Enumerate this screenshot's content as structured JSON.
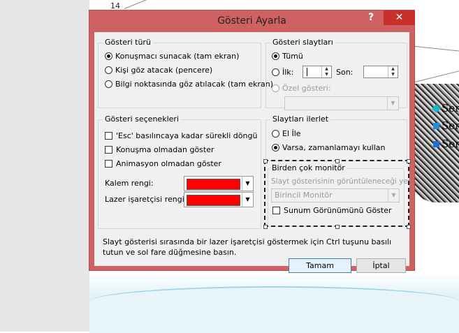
{
  "dialog": {
    "title": "Gösteri Ayarla",
    "help_glyph": "?",
    "close_glyph": "✕"
  },
  "show_type": {
    "group_label": "Gösteri türü",
    "options": [
      {
        "label": "Konuşmacı sunacak (tam ekran)",
        "selected": true
      },
      {
        "label": "Kişi göz atacak (pencere)",
        "selected": false
      },
      {
        "label": "Bilgi noktasında göz atılacak (tam ekran)",
        "selected": false
      }
    ]
  },
  "show_slides": {
    "group_label": "Gösteri slaytları",
    "all_label": "Tümü",
    "from_label": "İlk:",
    "to_label": "Son:",
    "from_value": "",
    "to_value": "",
    "custom_label": "Özel gösteri:",
    "custom_value": ""
  },
  "show_options": {
    "group_label": "Gösteri seçenekleri",
    "checks": [
      {
        "label": "'Esc' basılıncaya kadar sürekli döngü",
        "checked": false
      },
      {
        "label": "Konuşma olmadan göster",
        "checked": false
      },
      {
        "label": "Animasyon olmadan göster",
        "checked": false
      }
    ],
    "pen_color_label": "Kalem rengi:",
    "laser_color_label": "Lazer işaretçisi rengi:",
    "pen_color": "#ff0000",
    "laser_color": "#ff0000"
  },
  "advance_slides": {
    "group_label": "Slaytları ilerlet",
    "manual_label": "El İle",
    "timings_label": "Varsa, zamanlamayı kullan",
    "selected": "timings"
  },
  "monitors": {
    "group_label": "Birden çok monitör",
    "display_label": "Slayt gösterisinin görüntüleneceği yer:",
    "display_value": "Birincil Monitör",
    "presenter_view_label": "Sunum Görünümünü Göster",
    "presenter_view_checked": false
  },
  "hint_text": "Slayt gösterisi sırasında bir lazer işaretçisi göstermek için Ctrl tuşunu basılı tutun ve sol fare düğmesine basın.",
  "buttons": {
    "ok": "Tamam",
    "cancel": "İptal"
  },
  "background": {
    "top_text": "14",
    "bullets": [
      {
        "text": "Ser",
        "color": "#19b5c8"
      },
      {
        "text": "Ser",
        "color": "#1e8fd6"
      },
      {
        "text": "Ser",
        "color": "#1e6fd6"
      }
    ]
  }
}
